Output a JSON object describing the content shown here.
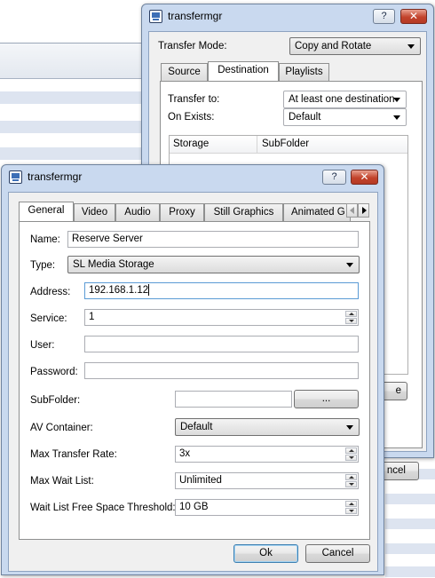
{
  "back_window": {
    "title": "transfermgr",
    "help_label": "?",
    "close_label": "✕",
    "transfer_mode_label": "Transfer Mode:",
    "transfer_mode_value": "Copy and Rotate",
    "tabs": [
      "Source",
      "Destination",
      "Playlists"
    ],
    "transfer_to_label": "Transfer to:",
    "transfer_to_value": "At least one destination",
    "on_exists_label": "On Exists:",
    "on_exists_value": "Default",
    "columns": [
      "Storage",
      "SubFolder"
    ],
    "partial_button_1": "e",
    "partial_button_2": "ncel"
  },
  "front_window": {
    "title": "transfermgr",
    "help_label": "?",
    "close_label": "✕",
    "tabs": [
      "General",
      "Video",
      "Audio",
      "Proxy",
      "Still Graphics",
      "Animated G"
    ],
    "name_label": "Name:",
    "name_value": "Reserve Server",
    "type_label": "Type:",
    "type_value": "SL Media Storage",
    "address_label": "Address:",
    "address_value": "192.168.1.12",
    "service_label": "Service:",
    "service_value": "1",
    "user_label": "User:",
    "user_value": "",
    "password_label": "Password:",
    "password_value": "",
    "subfolder_label": "SubFolder:",
    "subfolder_value": "",
    "browse_label": "...",
    "av_container_label": "AV Container:",
    "av_container_value": "Default",
    "max_transfer_rate_label": "Max Transfer Rate:",
    "max_transfer_rate_value": "3x",
    "max_wait_list_label": "Max Wait List:",
    "max_wait_list_value": "Unlimited",
    "threshold_label": "Wait List Free Space Threshold:",
    "threshold_value": "10 GB",
    "ok_label": "Ok",
    "cancel_label": "Cancel"
  },
  "colors": {
    "title_bar": "#c9d9ef",
    "dialog_face": "#f0f0f0",
    "close_button": "#c2432c",
    "focus_border": "#5b9bd5"
  }
}
